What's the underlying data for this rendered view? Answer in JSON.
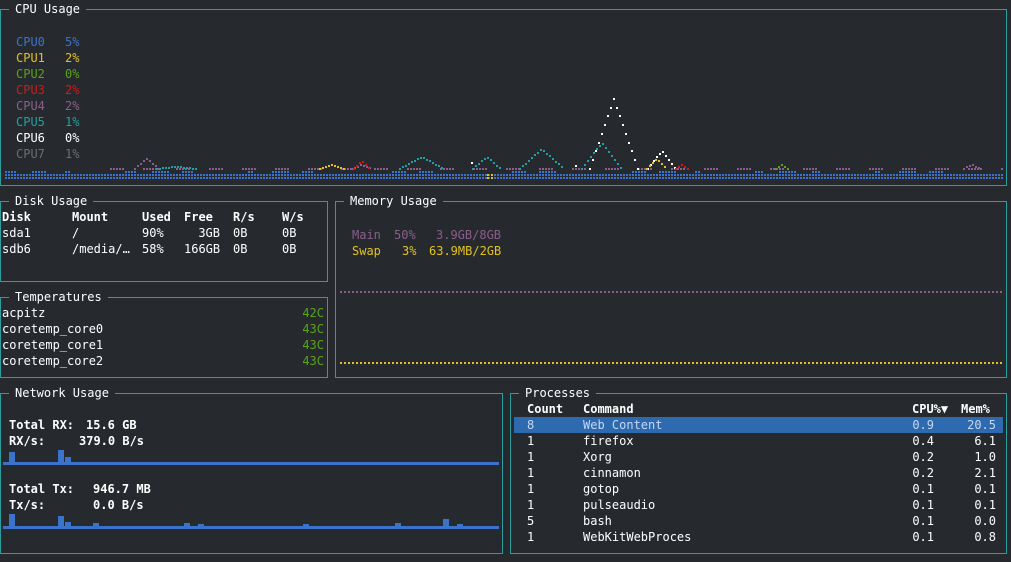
{
  "colors": {
    "border": "#2b9e9e",
    "background": "#262a2e",
    "blue": "#3a73c9",
    "yellow": "#e3c21f",
    "green": "#5aa31a",
    "red": "#d11a1a",
    "purple": "#8a5e8a",
    "teal": "#22a0a0",
    "white": "#ffffff",
    "gray": "#6d6d6d"
  },
  "cpu": {
    "title": "CPU Usage",
    "legend": [
      {
        "name": "CPU0",
        "value": "5%",
        "color": "#3a73c9"
      },
      {
        "name": "CPU1",
        "value": "2%",
        "color": "#e3c21f"
      },
      {
        "name": "CPU2",
        "value": "0%",
        "color": "#5aa31a"
      },
      {
        "name": "CPU3",
        "value": "2%",
        "color": "#d11a1a"
      },
      {
        "name": "CPU4",
        "value": "2%",
        "color": "#8a5e8a"
      },
      {
        "name": "CPU5",
        "value": "1%",
        "color": "#22a0a0"
      },
      {
        "name": "CPU6",
        "value": "0%",
        "color": "#ffffff"
      },
      {
        "name": "CPU7",
        "value": "1%",
        "color": "#6d6d6d"
      }
    ]
  },
  "disk": {
    "title": "Disk Usage",
    "headers": [
      "Disk",
      "Mount",
      "Used",
      "Free",
      "R/s",
      "W/s"
    ],
    "rows": [
      {
        "disk": "sda1",
        "mount": "/",
        "used": "90%",
        "free": "3GB",
        "rs": "0B",
        "ws": "0B"
      },
      {
        "disk": "sdb6",
        "mount": "/media/…",
        "used": "58%",
        "free": "166GB",
        "rs": "0B",
        "ws": "0B"
      }
    ]
  },
  "temps": {
    "title": "Temperatures",
    "rows": [
      {
        "name": "acpitz",
        "value": "42C"
      },
      {
        "name": "coretemp_core0",
        "value": "43C"
      },
      {
        "name": "coretemp_core1",
        "value": "43C"
      },
      {
        "name": "coretemp_core2",
        "value": "43C"
      }
    ]
  },
  "memory": {
    "title": "Memory Usage",
    "main": {
      "label": "Main",
      "percent": "50%",
      "amount": "3.9GB/8GB",
      "color": "#8a5e8a"
    },
    "swap": {
      "label": "Swap",
      "percent": "3%",
      "amount": "63.9MB/2GB",
      "color": "#e3c21f"
    }
  },
  "network": {
    "title": "Network Usage",
    "rx_total_label": "Total RX:",
    "rx_total": "15.6 GB",
    "rx_rate_label": "RX/s:",
    "rx_rate": "379.0 B/s",
    "tx_total_label": "Total Tx:",
    "tx_total": "946.7 MB",
    "tx_rate_label": "Tx/s:",
    "tx_rate": "0.0 B/s"
  },
  "processes": {
    "title": "Processes",
    "headers": {
      "count": "Count",
      "command": "Command",
      "cpu": "CPU%▼",
      "mem": "Mem%"
    },
    "rows": [
      {
        "count": "8",
        "command": "Web Content",
        "cpu": "0.9",
        "mem": "20.5",
        "selected": true
      },
      {
        "count": "1",
        "command": "firefox",
        "cpu": "0.4",
        "mem": "6.1"
      },
      {
        "count": "1",
        "command": "Xorg",
        "cpu": "0.2",
        "mem": "1.0"
      },
      {
        "count": "1",
        "command": "cinnamon",
        "cpu": "0.2",
        "mem": "2.1"
      },
      {
        "count": "1",
        "command": "gotop",
        "cpu": "0.1",
        "mem": "0.1"
      },
      {
        "count": "1",
        "command": "pulseaudio",
        "cpu": "0.1",
        "mem": "0.1"
      },
      {
        "count": "5",
        "command": "bash",
        "cpu": "0.1",
        "mem": "0.0"
      },
      {
        "count": "1",
        "command": "WebKitWebProces",
        "cpu": "0.1",
        "mem": "0.8"
      }
    ]
  }
}
